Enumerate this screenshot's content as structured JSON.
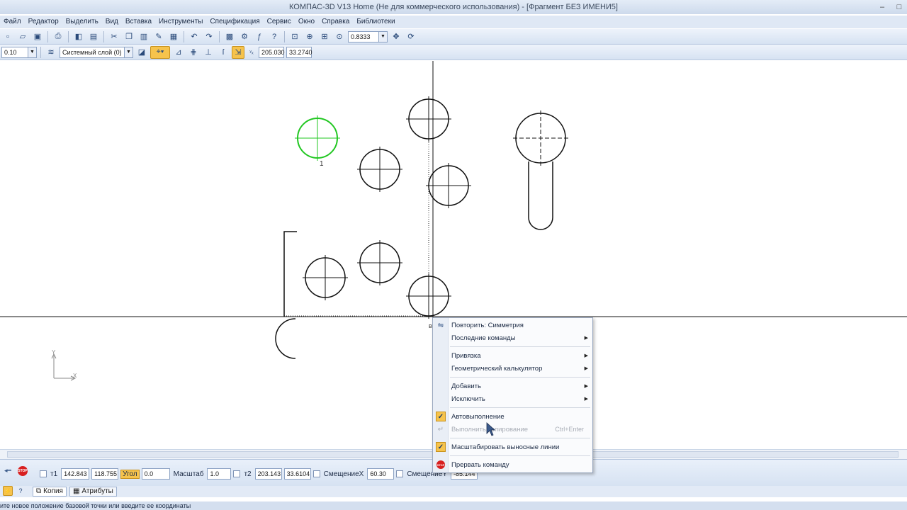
{
  "window": {
    "title": "КОМПАС-3D V13 Home (Не для коммерческого использования) - [Фрагмент БЕЗ ИМЕНИ5]",
    "controls": [
      "–",
      "□"
    ]
  },
  "menu": [
    "Файл",
    "Редактор",
    "Выделить",
    "Вид",
    "Вставка",
    "Инструменты",
    "Спецификация",
    "Сервис",
    "Окно",
    "Справка",
    "Библиотеки"
  ],
  "toolbar1": {
    "zoom_value": "0.8333"
  },
  "toolbar2": {
    "step_value": "0.10",
    "layer_value": "Системный слой (0)",
    "x_coord": "205.030",
    "y_coord": "33.2740"
  },
  "canvas": {
    "point_label": "1",
    "base_label": "в",
    "axis_y": "Y",
    "axis_x": "X",
    "colors": {
      "selected": "#22c722",
      "stroke": "#111111"
    }
  },
  "context_menu": {
    "items": [
      {
        "label": "Повторить: Симметрия",
        "icon": "symmetry-icon",
        "enabled": true
      },
      {
        "label": "Последние команды",
        "submenu": true,
        "enabled": true
      },
      {
        "label": "Привязка",
        "submenu": true,
        "enabled": true
      },
      {
        "label": "Геометрический калькулятор",
        "submenu": true,
        "enabled": true
      },
      {
        "label": "Добавить",
        "submenu": true,
        "enabled": true
      },
      {
        "label": "Исключить",
        "submenu": true,
        "enabled": true
      },
      {
        "label": "Автовыполнение",
        "checked": true,
        "enabled": true
      },
      {
        "label": "Выполнить копирование",
        "shortcut": "Ctrl+Enter",
        "enabled": false
      },
      {
        "label": "Масштабировать выносные линии",
        "checked": true,
        "enabled": true
      },
      {
        "label": "Прервать команду",
        "icon": "stop-icon",
        "enabled": true
      }
    ]
  },
  "propbar": {
    "t1_label": "т1",
    "t1_x": "142.843",
    "t1_y": "118.755",
    "angle_label": "Угол",
    "angle_value": "0.0",
    "scale_label": "Масштаб",
    "scale_value": "1.0",
    "t2_label": "т2",
    "t2_x": "203.143",
    "t2_y": "33.6104",
    "shiftx_label": "СмещениеX",
    "shiftx_value": "60.30",
    "shifty_label": "СмещениеY",
    "shifty_value": "-85.144"
  },
  "tabs": [
    "Копия",
    "Атрибуты"
  ],
  "status": "ите новое положение базовой точки или введите ее координаты"
}
